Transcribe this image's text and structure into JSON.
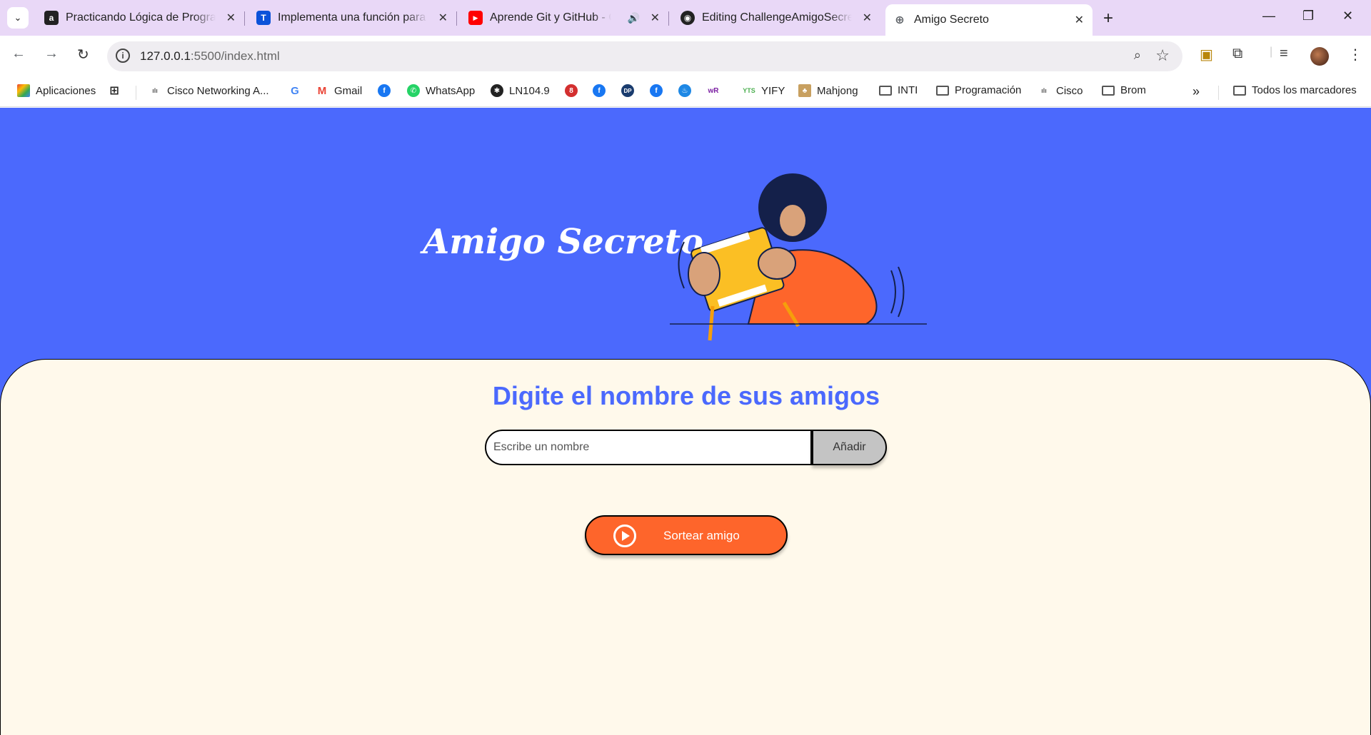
{
  "browser": {
    "tabs": [
      {
        "title": "Practicando Lógica de Programación",
        "favicon": "a",
        "favicon_color": "#222222"
      },
      {
        "title": "Implementa una función para agregar",
        "favicon": "T",
        "favicon_color": "#0b52d9"
      },
      {
        "title": "Aprende Git y GitHub - Curso",
        "favicon": "▶",
        "favicon_color": "#ff0000",
        "audio": "🔊"
      },
      {
        "title": "Editing ChallengeAmigoSecreto",
        "favicon": "◉",
        "favicon_color": "#222222"
      },
      {
        "title": "Amigo Secreto",
        "favicon": "🌐",
        "favicon_color": "#5f6368",
        "active": true
      }
    ],
    "new_tab": "+",
    "url": {
      "host": "127.0.0.1",
      "rest": ":5500/index.html"
    },
    "bookmarks": [
      {
        "label": "Aplicaciones",
        "icon": "apps-icon"
      },
      {
        "label": "",
        "icon": "grid-icon"
      },
      {
        "label": "Cisco Networking A...",
        "icon": "cisco-icon"
      },
      {
        "label": "",
        "icon": "google-icon"
      },
      {
        "label": "Gmail",
        "icon": "gmail-icon"
      },
      {
        "label": "",
        "icon": "facebook-icon"
      },
      {
        "label": "WhatsApp",
        "icon": "whatsapp-icon"
      },
      {
        "label": "LN104.9",
        "icon": "ln-icon"
      },
      {
        "label": "",
        "icon": "site-icon"
      },
      {
        "label": "",
        "icon": "facebook-icon"
      },
      {
        "label": "",
        "icon": "dp-icon"
      },
      {
        "label": "",
        "icon": "facebook-icon"
      },
      {
        "label": "",
        "icon": "flame-icon"
      },
      {
        "label": "",
        "icon": "wr-icon"
      },
      {
        "label": "YIFY",
        "icon": "yify-icon"
      },
      {
        "label": "Mahjong",
        "icon": "mahjong-icon"
      },
      {
        "label": "INTI",
        "icon": "folder-icon"
      },
      {
        "label": "Programación",
        "icon": "folder-icon"
      },
      {
        "label": "Cisco",
        "icon": "cisco-icon"
      },
      {
        "label": "Brom",
        "icon": "folder-icon"
      }
    ],
    "overflow": "»",
    "all_bookmarks": "Todos los marcadores"
  },
  "page": {
    "hero_title": "Amigo Secreto",
    "section_title": "Digite el nombre de sus amigos",
    "input_placeholder": "Escribe un nombre",
    "add_label": "Añadir",
    "draw_label": "Sortear amigo"
  },
  "colors": {
    "hero_bg": "#4b69fd",
    "card_bg": "#fff9eb",
    "accent_orange": "#fe652b",
    "button_gray": "#c4c4c4"
  }
}
